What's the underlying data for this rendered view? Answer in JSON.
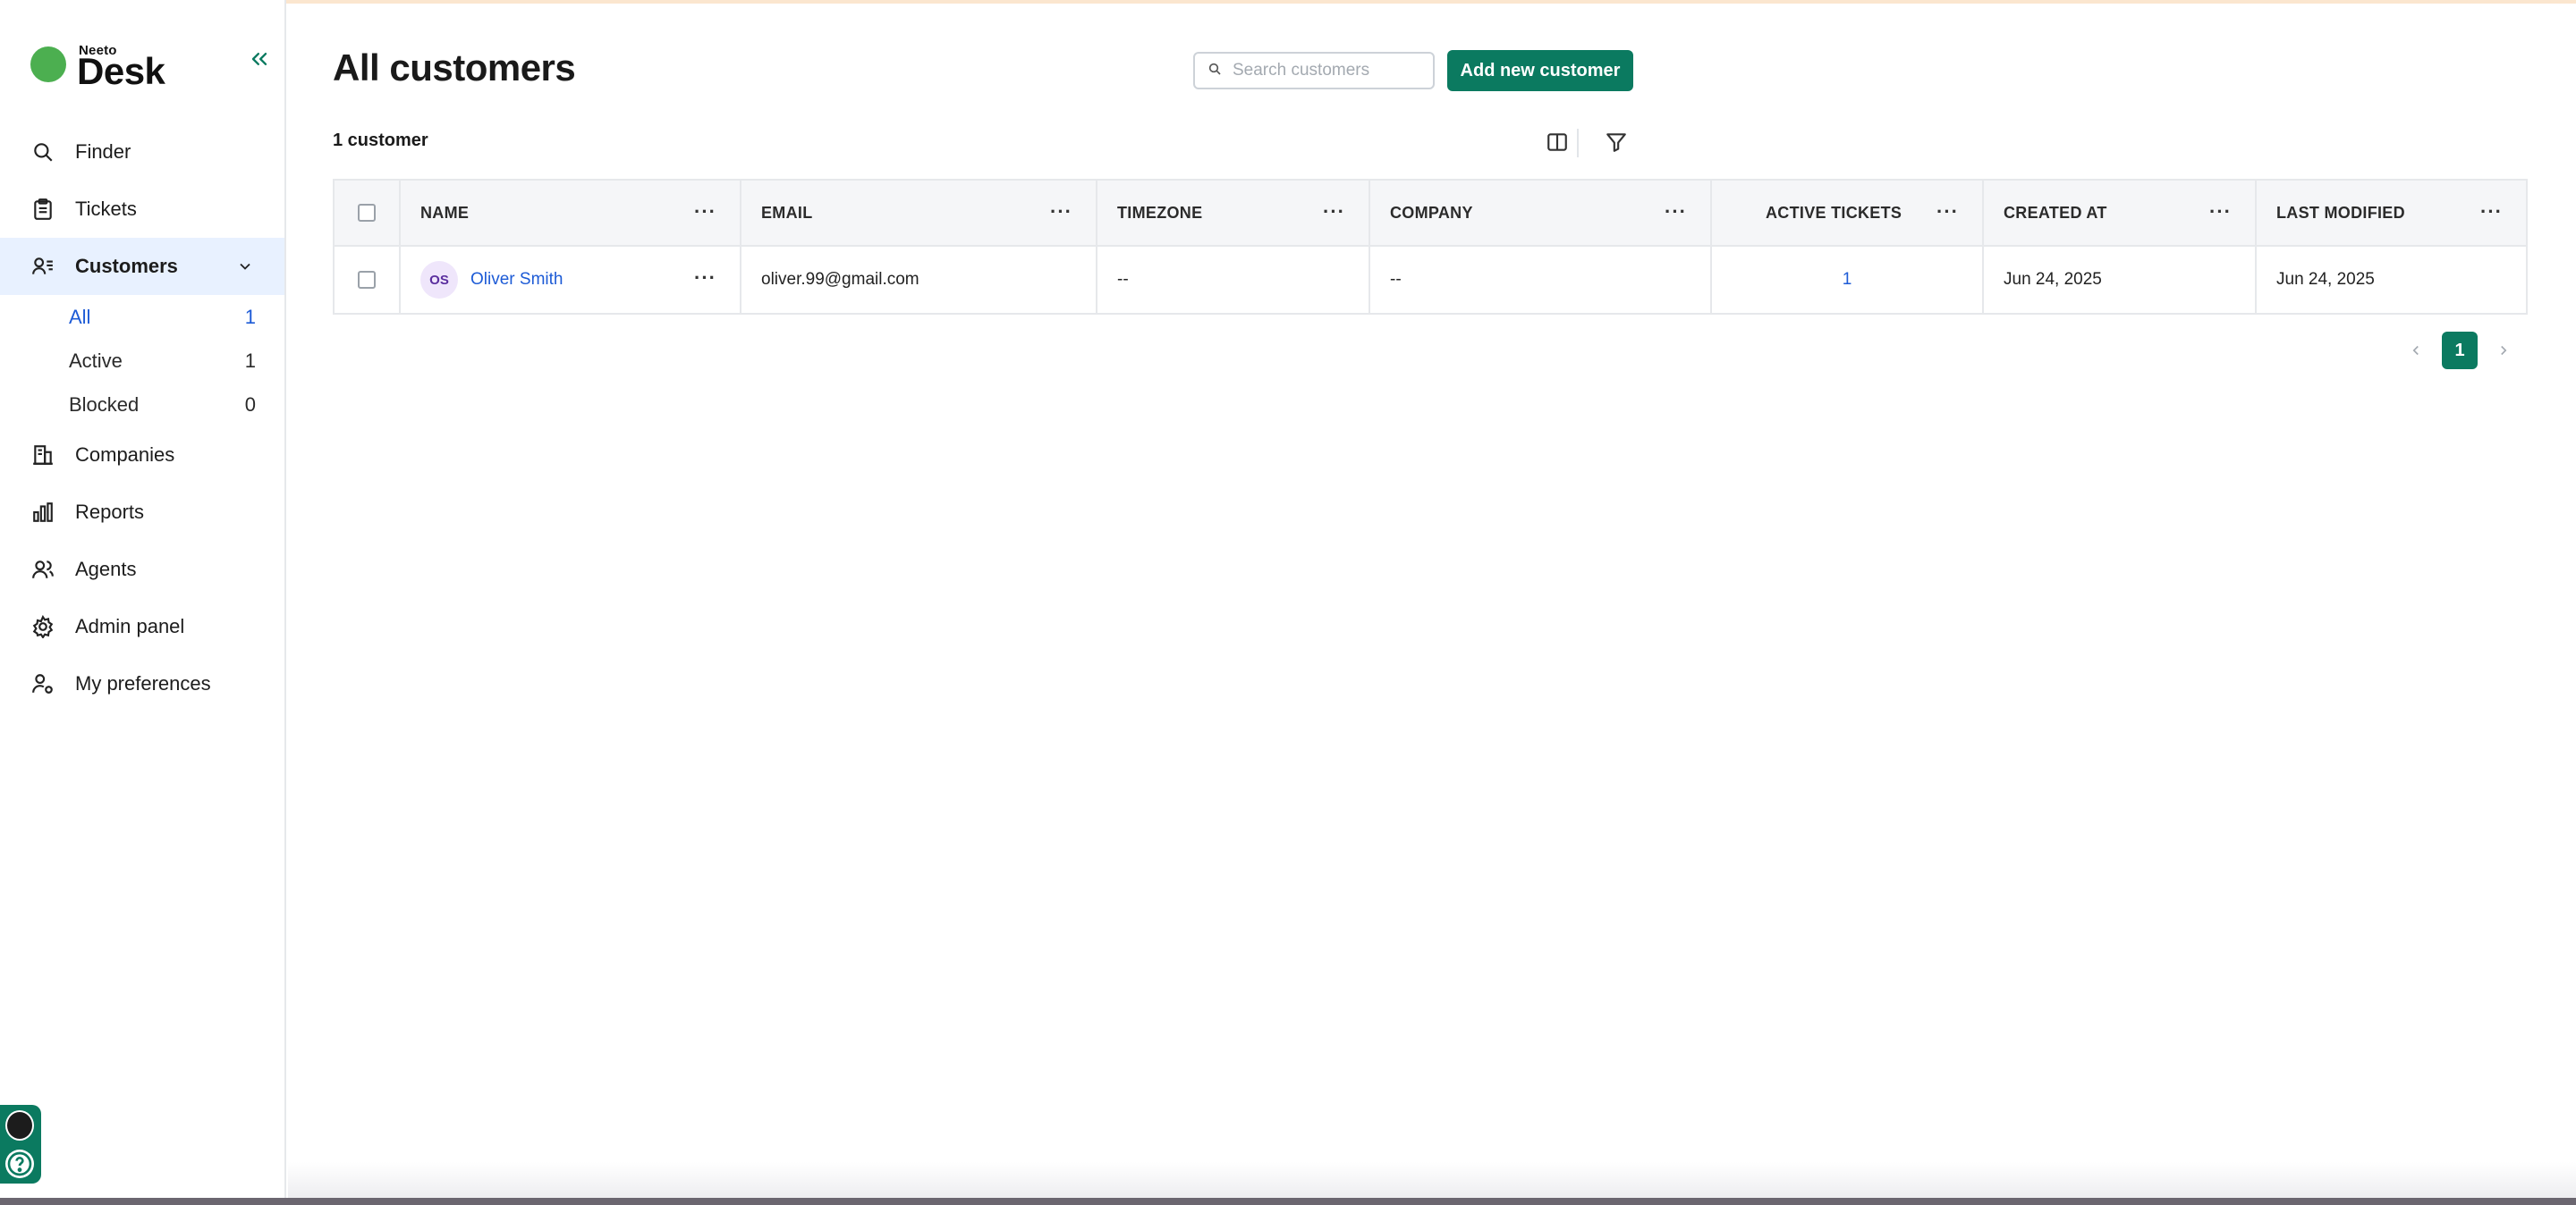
{
  "logo": {
    "small": "Neeto",
    "big": "Desk"
  },
  "sidebar": {
    "items": [
      {
        "id": "finder",
        "label": "Finder"
      },
      {
        "id": "tickets",
        "label": "Tickets"
      },
      {
        "id": "customers",
        "label": "Customers"
      },
      {
        "id": "companies",
        "label": "Companies"
      },
      {
        "id": "reports",
        "label": "Reports"
      },
      {
        "id": "agents",
        "label": "Agents"
      },
      {
        "id": "admin",
        "label": "Admin panel"
      },
      {
        "id": "preferences",
        "label": "My preferences"
      }
    ],
    "customer_filters": [
      {
        "label": "All",
        "count": "1"
      },
      {
        "label": "Active",
        "count": "1"
      },
      {
        "label": "Blocked",
        "count": "0"
      }
    ]
  },
  "main": {
    "title": "All customers",
    "search_placeholder": "Search customers",
    "add_button": "Add new customer",
    "count_label": "1 customer"
  },
  "table": {
    "columns": [
      "NAME",
      "EMAIL",
      "TIMEZONE",
      "COMPANY",
      "ACTIVE TICKETS",
      "CREATED AT",
      "LAST MODIFIED"
    ],
    "rows": [
      {
        "initials": "OS",
        "name": "Oliver Smith",
        "email": "oliver.99@gmail.com",
        "timezone": "--",
        "company": "--",
        "active_tickets": "1",
        "created_at": "Jun 24, 2025",
        "last_modified": "Jun 24, 2025"
      }
    ]
  },
  "pagination": {
    "current": "1"
  },
  "colors": {
    "primary": "#0b7a60",
    "link": "#1d5bd6",
    "active_bg": "#e8f1ff"
  },
  "icons": {
    "finder": "search-icon",
    "tickets": "clipboard-icon",
    "customers": "users-list-icon",
    "companies": "building-icon",
    "reports": "bar-chart-icon",
    "agents": "users-icon",
    "admin": "gear-icon",
    "preferences": "user-settings-icon"
  }
}
